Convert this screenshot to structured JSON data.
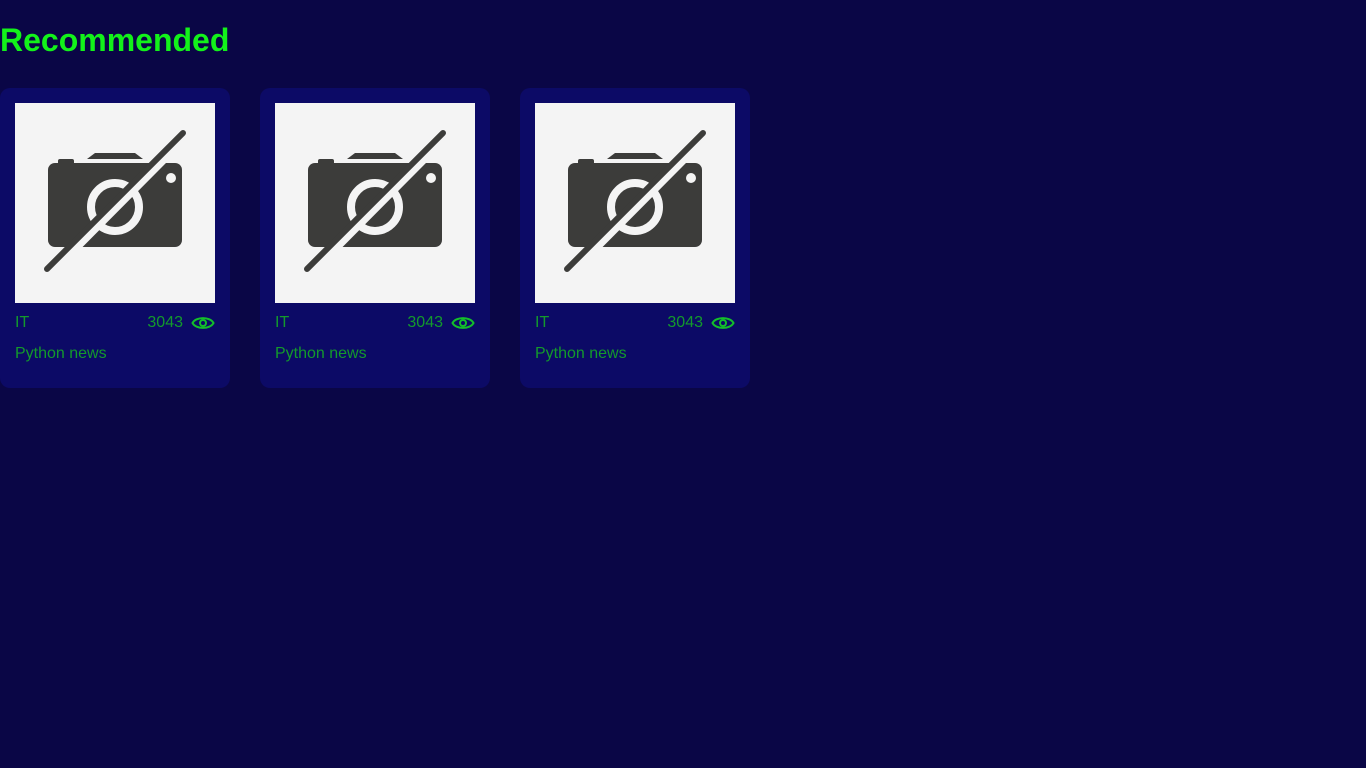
{
  "page": {
    "heading": "Recommended"
  },
  "colors": {
    "background": "#0a0646",
    "card": "#0c0a66",
    "accent": "#13f21a",
    "text": "#139a2c"
  },
  "cards": [
    {
      "category": "IT",
      "views": "3043",
      "title": "Python news",
      "image_icon": "no-photo-icon",
      "views_icon": "eye-icon"
    },
    {
      "category": "IT",
      "views": "3043",
      "title": "Python news",
      "image_icon": "no-photo-icon",
      "views_icon": "eye-icon"
    },
    {
      "category": "IT",
      "views": "3043",
      "title": "Python news",
      "image_icon": "no-photo-icon",
      "views_icon": "eye-icon"
    }
  ]
}
